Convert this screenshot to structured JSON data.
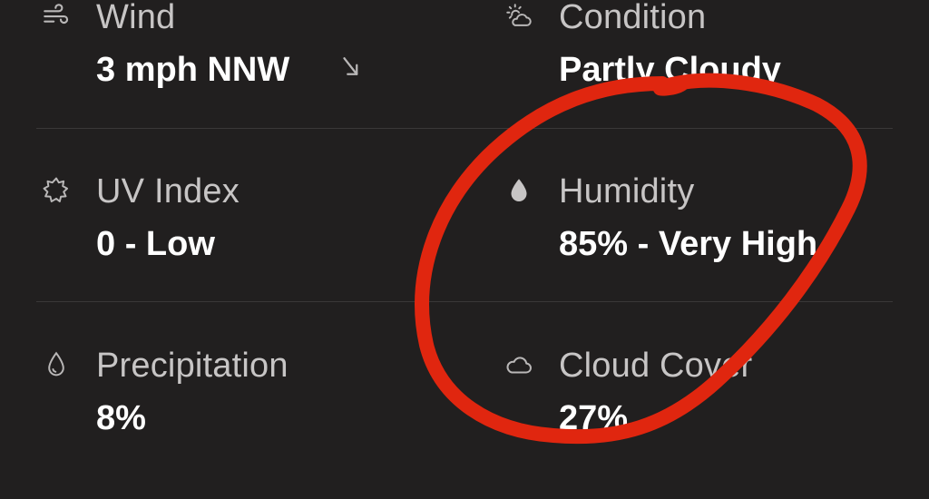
{
  "accent_color": "#e0260f",
  "weather_details": [
    {
      "icon": "wind-icon",
      "label": "Wind",
      "value": "3 mph NNW",
      "direction_icon": "arrow-down-left-icon"
    },
    {
      "icon": "partly-cloudy-icon",
      "label": "Condition",
      "value": "Partly Cloudy"
    },
    {
      "icon": "uv-sun-icon",
      "label": "UV Index",
      "value": "0 - Low"
    },
    {
      "icon": "humidity-drop-icon",
      "label": "Humidity",
      "value": "85% - Very High"
    },
    {
      "icon": "precipitation-drop-icon",
      "label": "Precipitation",
      "value": "8%"
    },
    {
      "icon": "cloud-icon",
      "label": "Cloud Cover",
      "value": "27%"
    }
  ]
}
